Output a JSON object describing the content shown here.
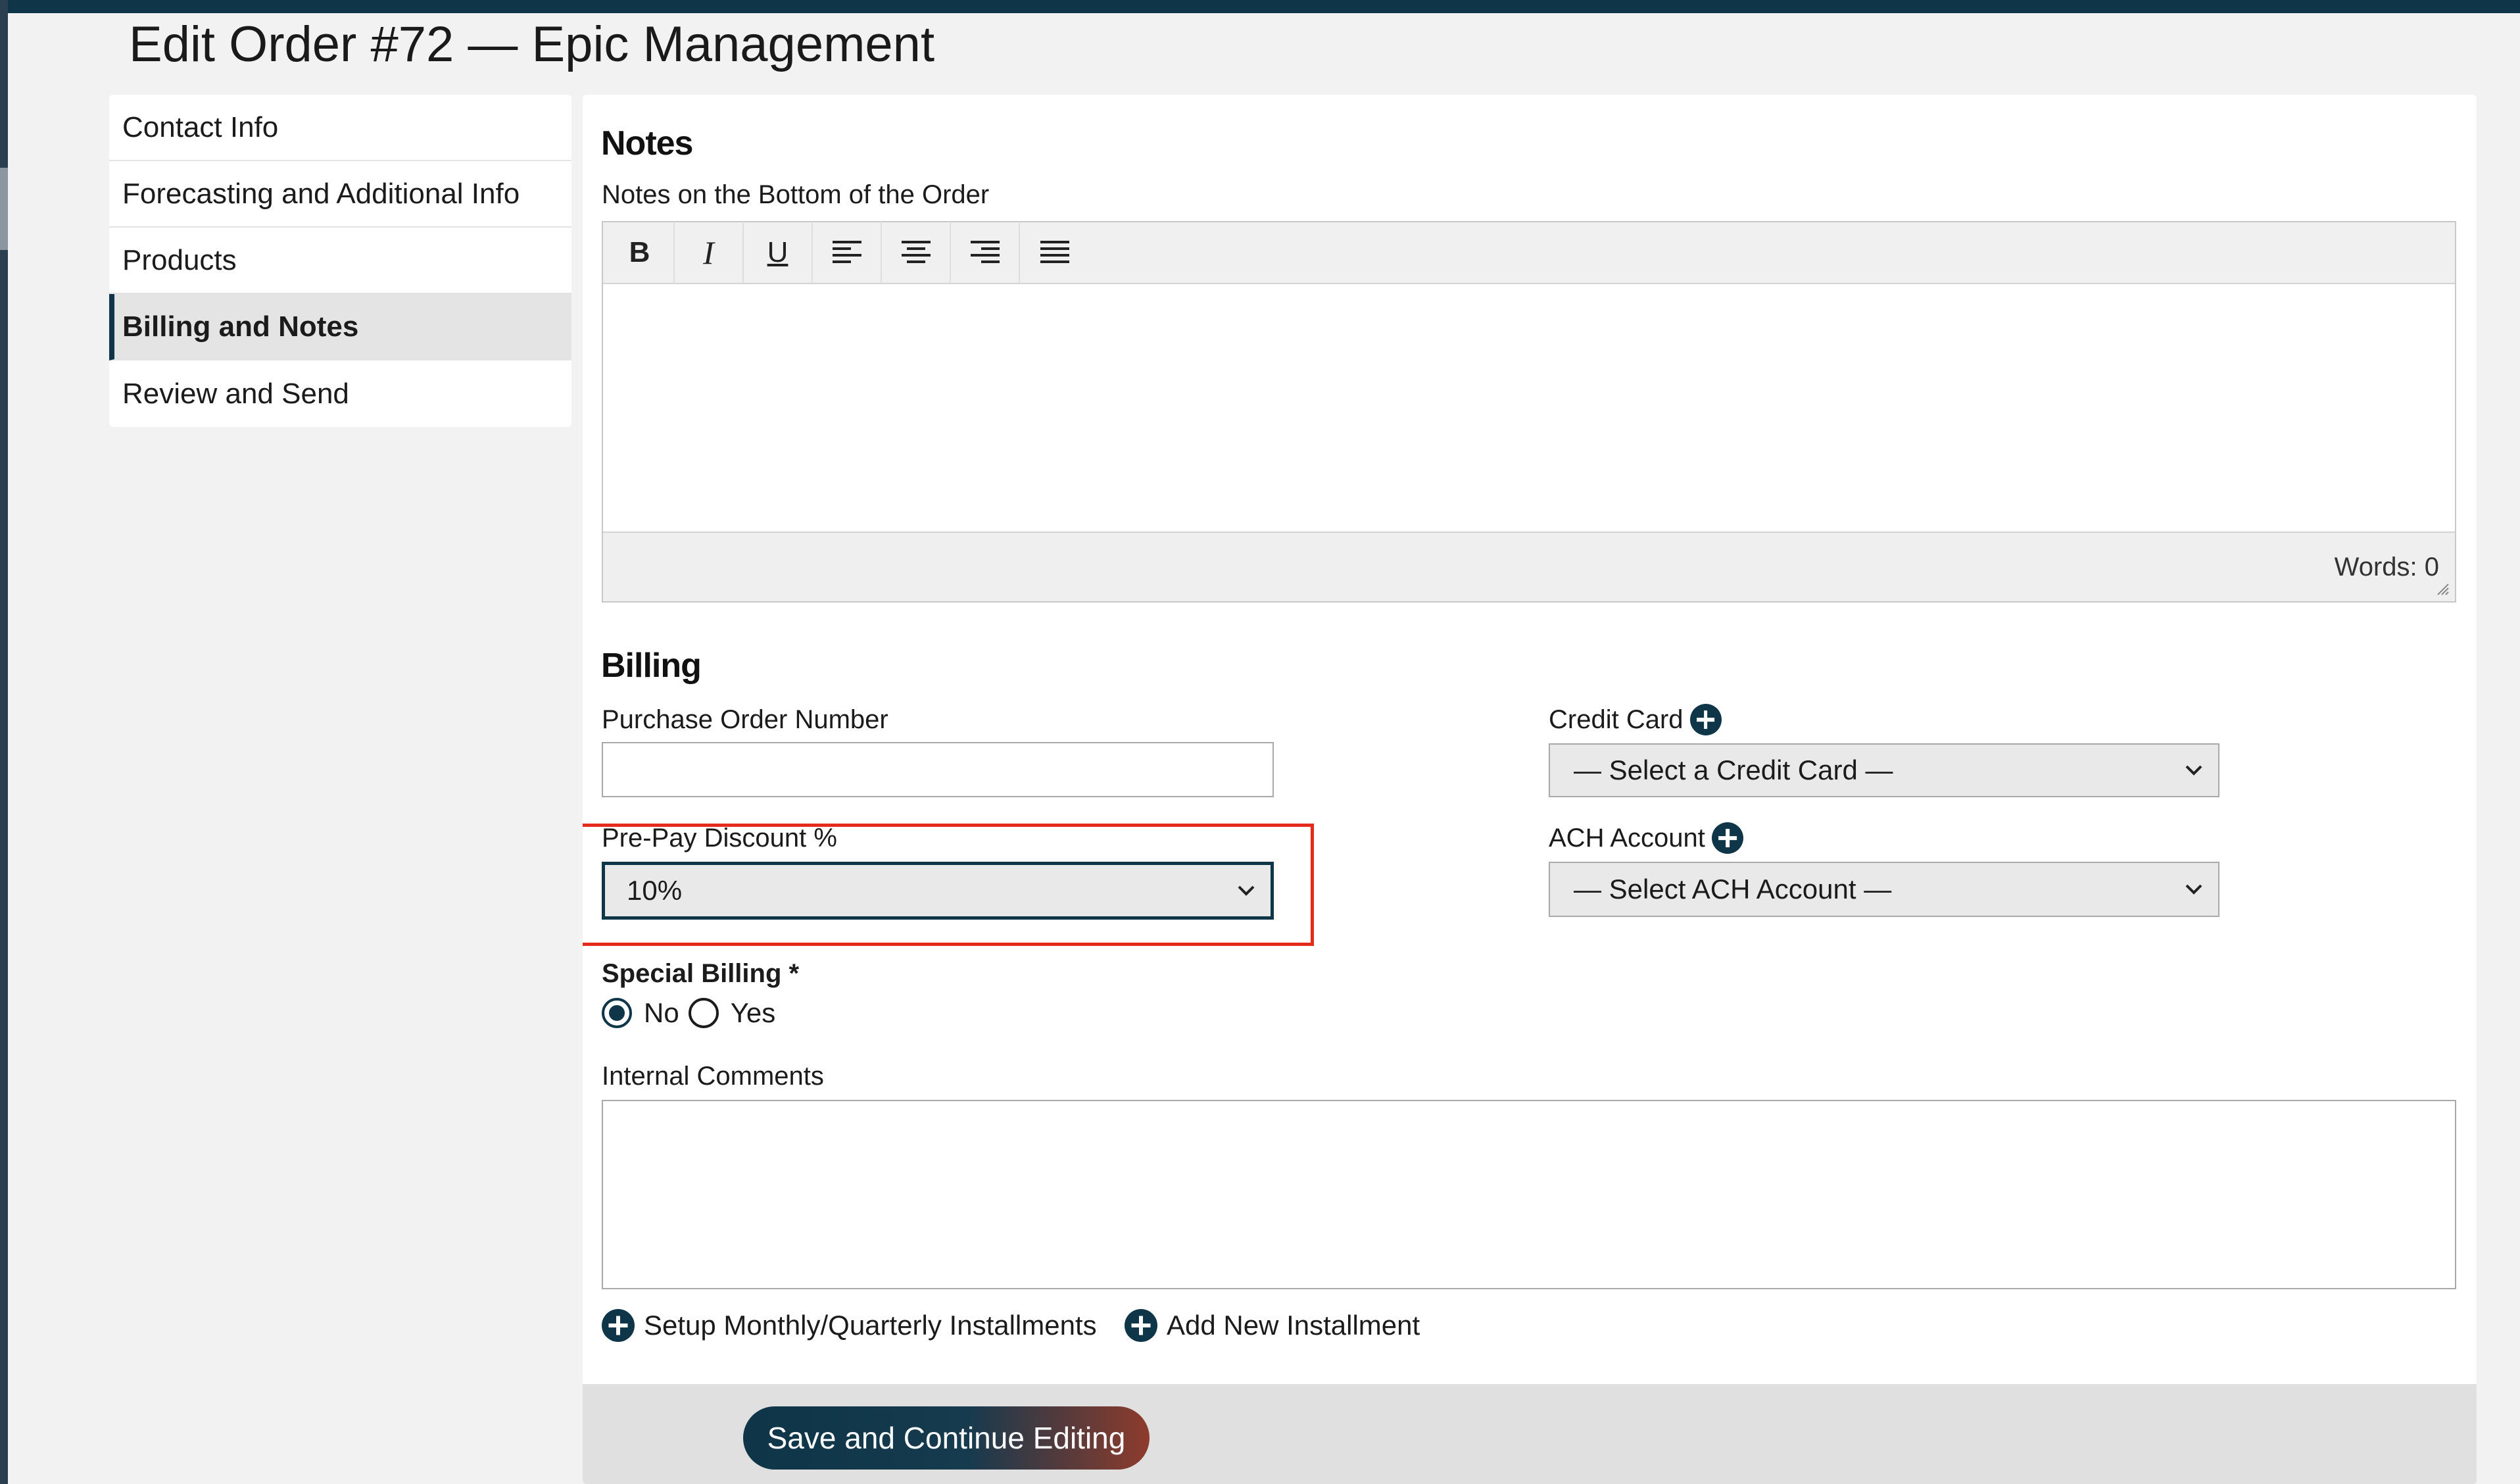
{
  "page": {
    "title": "Edit Order #72 — Epic Management"
  },
  "sidebar": {
    "items": [
      {
        "label": "Contact Info",
        "active": false
      },
      {
        "label": "Forecasting and Additional Info",
        "active": false
      },
      {
        "label": "Products",
        "active": false
      },
      {
        "label": "Billing and Notes",
        "active": true
      },
      {
        "label": "Review and Send",
        "active": false
      }
    ]
  },
  "notes": {
    "section_title": "Notes",
    "field_label": "Notes on the Bottom of the Order",
    "toolbar": {
      "bold": "B",
      "italic": "I",
      "underline": "U",
      "buttons": [
        "bold",
        "italic",
        "underline",
        "align-left",
        "align-center",
        "align-right",
        "justify"
      ]
    },
    "value": "",
    "word_count": "Words: 0"
  },
  "billing": {
    "section_title": "Billing",
    "po_label": "Purchase Order Number",
    "po_value": "",
    "prepay_label": "Pre-Pay Discount %",
    "prepay_value": "10%",
    "credit_card_label": "Credit Card",
    "credit_card_value": "— Select a Credit Card —",
    "ach_label": "ACH Account",
    "ach_value": "— Select ACH Account —",
    "special_billing_label": "Special Billing *",
    "special_billing_options": [
      {
        "label": "No",
        "checked": true
      },
      {
        "label": "Yes",
        "checked": false
      }
    ],
    "internal_comments_label": "Internal Comments",
    "internal_comments_value": "",
    "setup_installments_link": "Setup Monthly/Quarterly Installments",
    "add_installment_link": "Add New Installment"
  },
  "footer": {
    "save_label": "Save and Continue Editing"
  },
  "colors": {
    "primary": "#0e3548",
    "highlight_border": "#e52b1b",
    "save_gradient_end": "#8e3b2c"
  }
}
